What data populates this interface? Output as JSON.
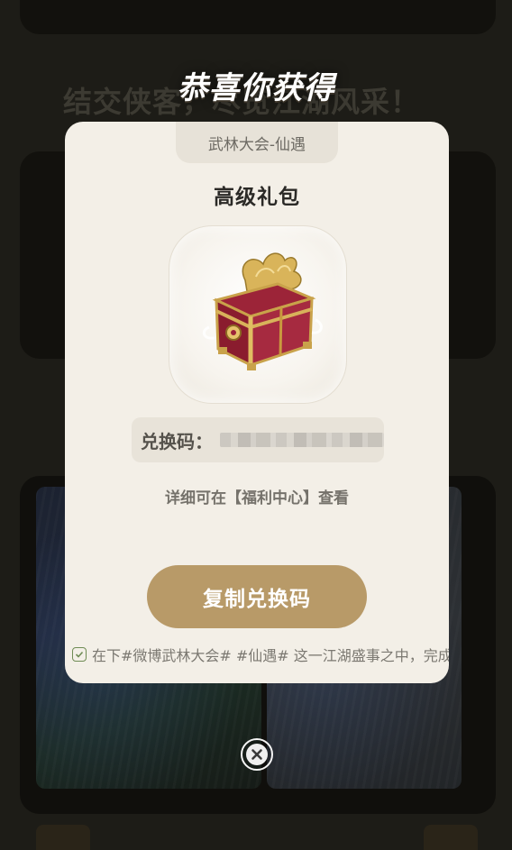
{
  "popup": {
    "title": "恭喜你获得",
    "event_tag": "武林大会-仙遇",
    "gift_name": "高级礼包",
    "gift_icon": "treasure-chest-icon",
    "code_label": "兑换码：",
    "code_value_visible": false,
    "detail_text": "详细可在【福利中心】查看",
    "copy_button_label": "复制兑换码",
    "share_checked": true,
    "share_text": "在下#微博武林大会# #仙遇# 这一江湖盛事之中，完成互动任务",
    "close_icon": "close-icon"
  },
  "background": {
    "banner_text": "结交侠客，尽览江湖风采！"
  },
  "colors": {
    "modal_bg": "#f3efe7",
    "button_gold": "#b89a68",
    "overlay_dark": "#1d1c17",
    "checkbox_green": "#6f8c55"
  }
}
